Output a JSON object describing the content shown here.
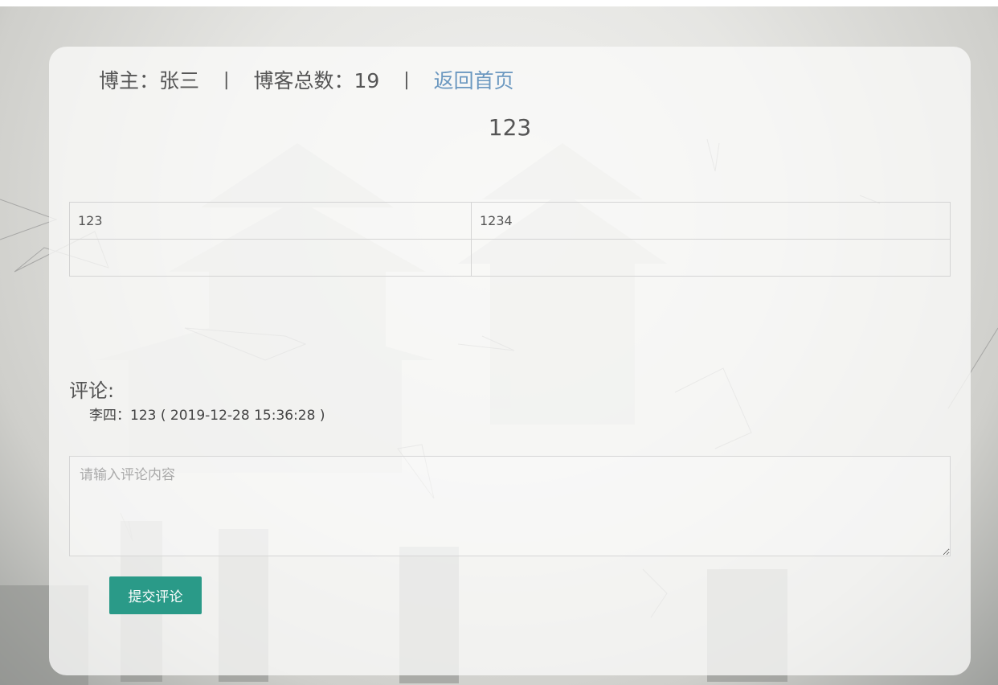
{
  "header": {
    "blogger_label": "博主：张三",
    "separator": "|",
    "total_label": "博客总数：19",
    "home_link": "返回首页"
  },
  "post": {
    "title": "123",
    "table": [
      [
        "123",
        "1234"
      ],
      [
        "",
        ""
      ]
    ]
  },
  "comments": {
    "label": "评论:",
    "items": [
      {
        "text": "李四：123 ( 2019-12-28 15:36:28 )"
      }
    ],
    "input_placeholder": "请输入评论内容",
    "submit_label": "提交评论"
  },
  "colors": {
    "accent": "#2a9a88",
    "link": "#6b98c0"
  }
}
